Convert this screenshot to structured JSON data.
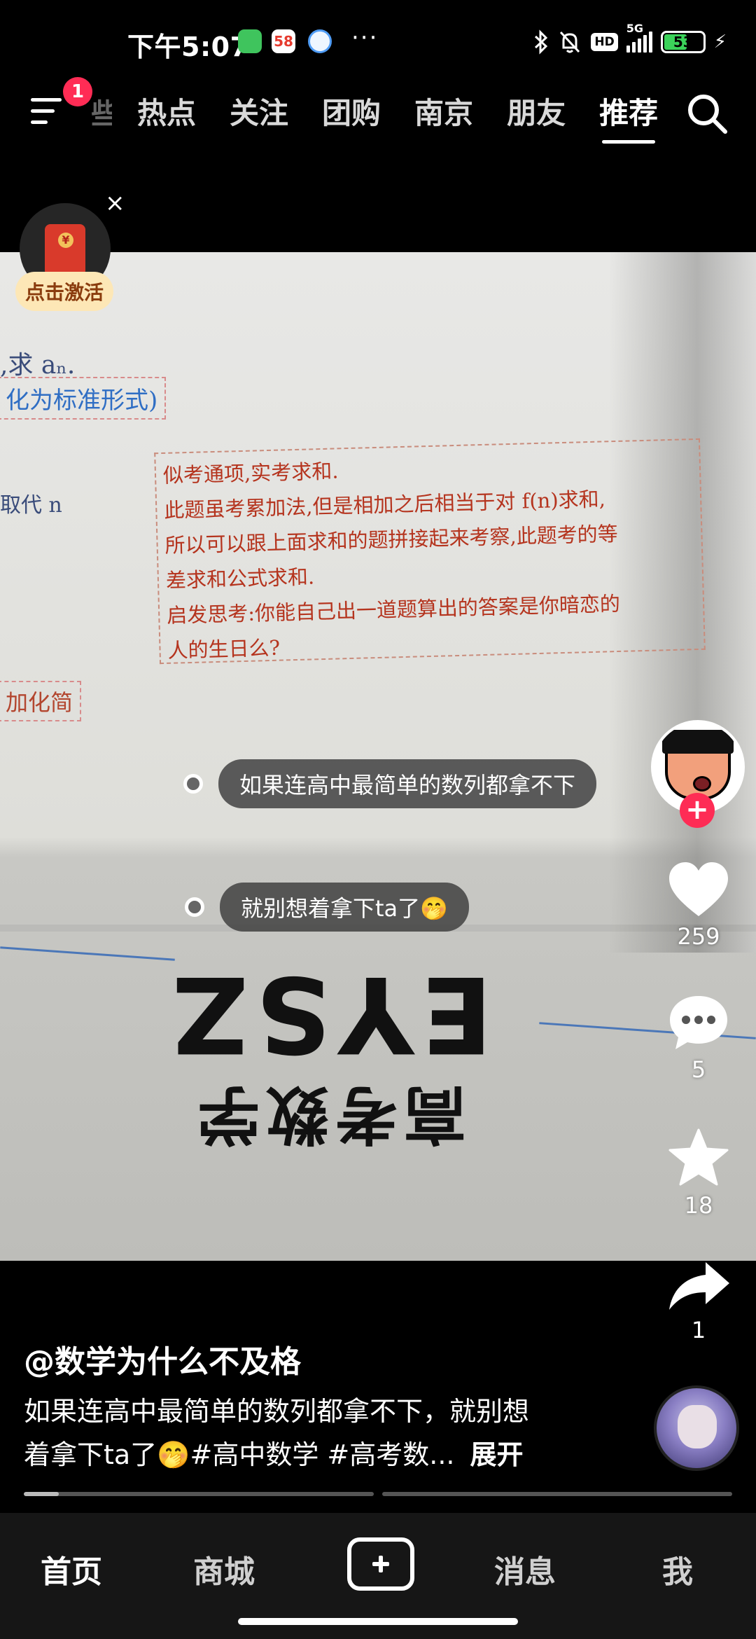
{
  "status_bar": {
    "time": "下午5:07",
    "app_58_label": "58",
    "more": "···",
    "hd": "HD",
    "network": "5G",
    "battery_level": "53",
    "charging": "⚡"
  },
  "top_nav": {
    "notification_count": "1",
    "partial_tab": "些",
    "tabs": [
      "热点",
      "关注",
      "团购",
      "南京",
      "朋友",
      "推荐"
    ],
    "active_tab": "推荐"
  },
  "promo": {
    "close": "×",
    "activate_label": "点击激活"
  },
  "video": {
    "book_formula": ",求 aₙ.",
    "book_blue_box": "化为标准形式)",
    "book_blue_small": "取代 n",
    "book_red_box": "加化简",
    "handwritten_lines": [
      "似考通项,实考求和.",
      "此题虽考累加法,但是相加之后相当于对 f(n)求和,",
      "所以可以跟上面求和的题拼接起来考察,此题考的等",
      "差求和公式求和.",
      "启发思考:你能自己出一道题算出的答案是你暗恋的",
      "人的生日么?"
    ],
    "cover_title": "高考数学",
    "cover_brand": "EYSZ",
    "captions": [
      "如果连高中最简单的数列都拿不下",
      "就别想着拿下ta了🤭"
    ]
  },
  "actions": {
    "follow_plus": "+",
    "likes": "259",
    "comments": "5",
    "favorites": "18",
    "shares": "1"
  },
  "info": {
    "author": "@数学为什么不及格",
    "description_line1": "如果连高中最简单的数列都拿不下，就别想",
    "description_line2": "着拿下ta了🤭#高中数学 #高考数...",
    "expand": "展开",
    "progress": [
      0.1,
      0.0
    ]
  },
  "bottom_nav": {
    "items": [
      "首页",
      "商城",
      "消息",
      "我"
    ]
  },
  "colors": {
    "accent_red": "#fe2c55",
    "background": "#000000",
    "nav_background": "#161616"
  }
}
